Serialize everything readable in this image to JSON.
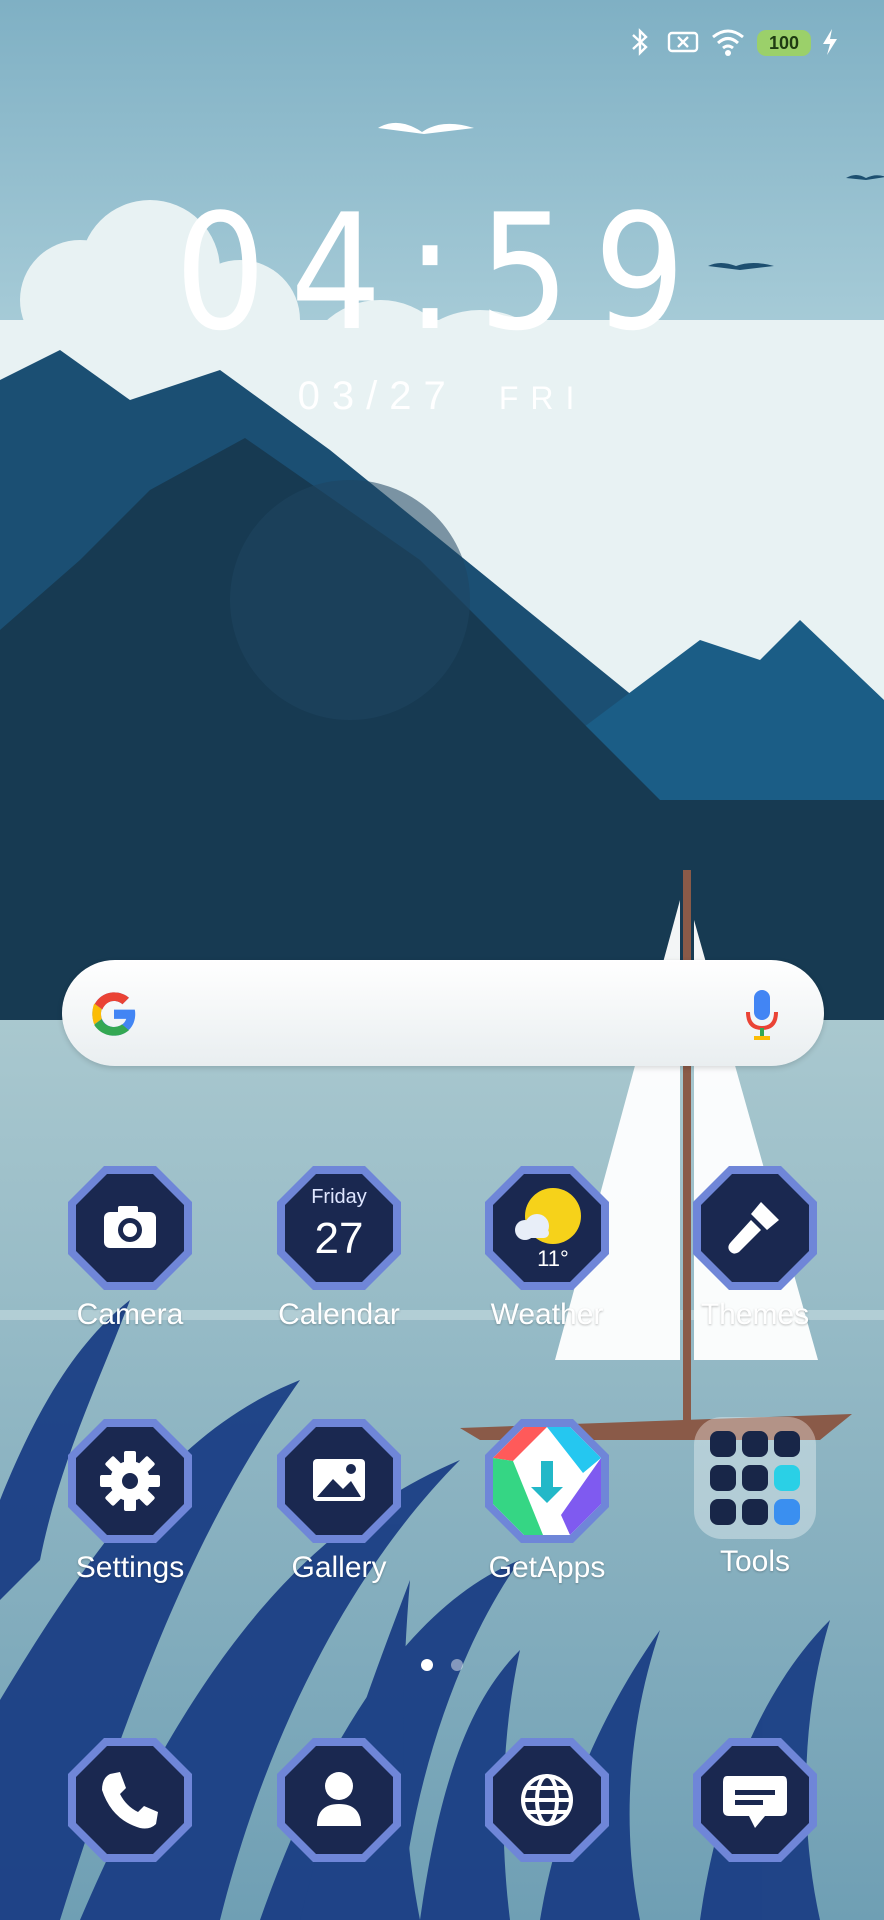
{
  "status_bar": {
    "battery": "100"
  },
  "lockscreen_clock": {
    "time": "04:59",
    "date": "03/27",
    "weekday": "FRI"
  },
  "search_bar": {
    "placeholder": ""
  },
  "home": {
    "apps": [
      {
        "name": "Camera",
        "icon": "camera-icon"
      },
      {
        "name": "Calendar",
        "icon": "calendar-icon",
        "day_name": "Friday",
        "day_number": "27"
      },
      {
        "name": "Weather",
        "icon": "weather-sun-cloud-icon",
        "temp": "11°"
      },
      {
        "name": "Themes",
        "icon": "paintbrush-icon"
      },
      {
        "name": "Settings",
        "icon": "gear-icon"
      },
      {
        "name": "Gallery",
        "icon": "image-icon"
      },
      {
        "name": "GetApps",
        "icon": "getapps-download-icon"
      },
      {
        "name": "Tools",
        "icon": "folder-icon"
      }
    ],
    "page_indicator": {
      "pages": 2,
      "current": 1
    }
  },
  "dock": [
    {
      "icon": "phone-icon"
    },
    {
      "icon": "contacts-icon"
    },
    {
      "icon": "browser-globe-icon"
    },
    {
      "icon": "messages-icon"
    }
  ],
  "colors": {
    "icon_bg": "#1a2850",
    "icon_ring": "#6f86d8",
    "sky": "#9cc6d6",
    "mountain_dark": "#173a52"
  }
}
